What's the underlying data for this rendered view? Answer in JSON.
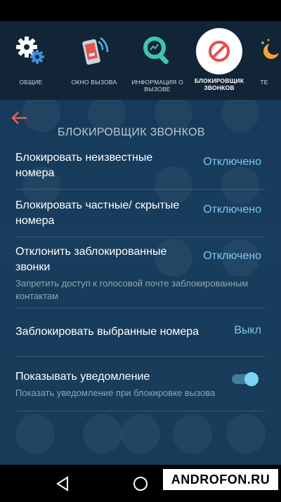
{
  "tabs": [
    {
      "label": "ОБЩИЕ",
      "icon": "gear-icon"
    },
    {
      "label": "ОКНО ВЫЗОВА",
      "icon": "phone-call-icon"
    },
    {
      "label": "ИНФОРМАЦИЯ О ВЫЗОВЕ",
      "icon": "magnifier-icon"
    },
    {
      "label": "БЛОКИРОВЩИК ЗВОНКОВ",
      "icon": "block-icon",
      "active": true
    },
    {
      "label": "ТЕ",
      "icon": "theme-icon"
    }
  ],
  "section_title": "БЛОКИРОВЩИК ЗВОНКОВ",
  "settings": [
    {
      "title": "Блокировать неизвестные номера",
      "value": "Отключено"
    },
    {
      "title": "Блокировать частные/ скрытые номера",
      "value": "Отключено"
    },
    {
      "title": "Отклонить заблокированные звонки",
      "value": "Отключено",
      "subtitle": "Запретить доступ к голосовой почте заблокированным контактам"
    },
    {
      "title": "Заблокировать выбранные номера",
      "value": "Выкл"
    },
    {
      "title": "Показывать уведомление",
      "subtitle": "Показать уведомление при блокировке вызова",
      "toggle": true
    }
  ],
  "watermark": "ANDROFON.RU",
  "colors": {
    "accent": "#7cc8f0",
    "back_arrow": "#e8605a",
    "block_icon": "#e74c4c"
  }
}
